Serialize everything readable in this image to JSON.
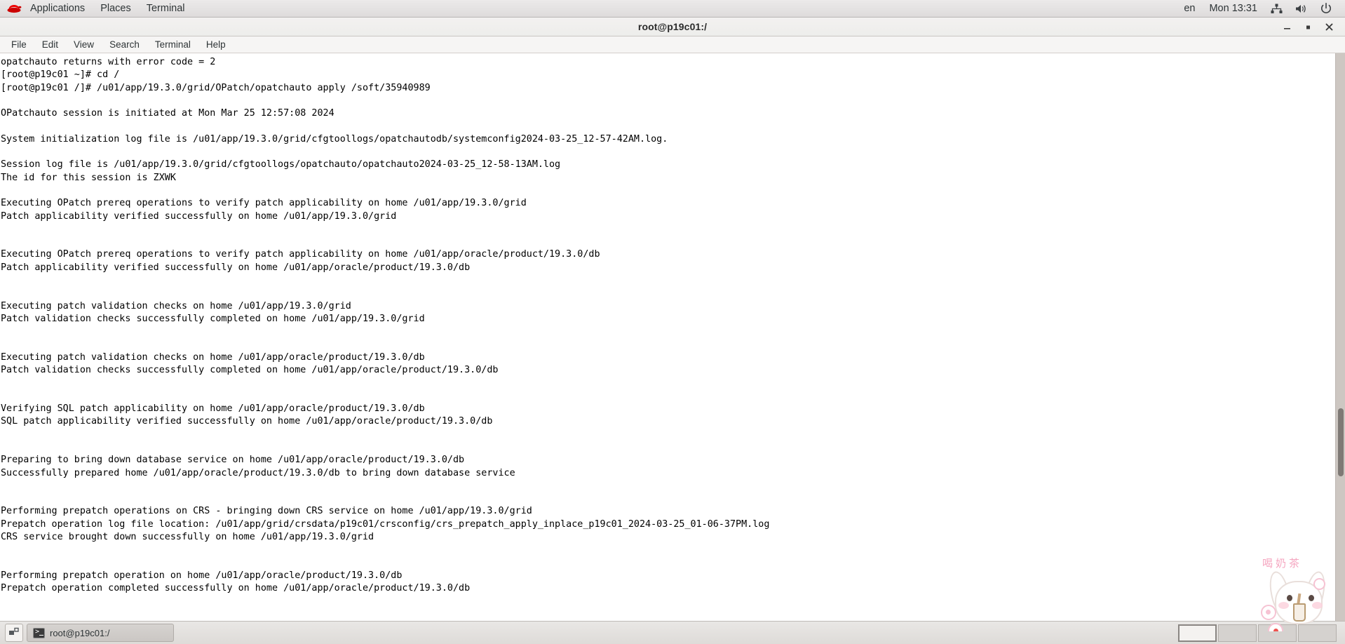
{
  "top_panel": {
    "logo_icon": "redhat-logo-icon",
    "menus": [
      "Applications",
      "Places",
      "Terminal"
    ],
    "language": "en",
    "clock": "Mon 13:31",
    "icons": [
      "network-icon",
      "volume-icon",
      "power-icon"
    ]
  },
  "window": {
    "title": "root@p19c01:/",
    "controls": {
      "minimize": "minimize-icon",
      "maximize": "maximize-icon",
      "close": "close-icon"
    },
    "menubar": [
      "File",
      "Edit",
      "View",
      "Search",
      "Terminal",
      "Help"
    ]
  },
  "terminal": {
    "content": "opatchauto returns with error code = 2\n[root@p19c01 ~]# cd /\n[root@p19c01 /]# /u01/app/19.3.0/grid/OPatch/opatchauto apply /soft/35940989\n\nOPatchauto session is initiated at Mon Mar 25 12:57:08 2024\n\nSystem initialization log file is /u01/app/19.3.0/grid/cfgtoollogs/opatchautodb/systemconfig2024-03-25_12-57-42AM.log.\n\nSession log file is /u01/app/19.3.0/grid/cfgtoollogs/opatchauto/opatchauto2024-03-25_12-58-13AM.log\nThe id for this session is ZXWK\n\nExecuting OPatch prereq operations to verify patch applicability on home /u01/app/19.3.0/grid\nPatch applicability verified successfully on home /u01/app/19.3.0/grid\n\n\nExecuting OPatch prereq operations to verify patch applicability on home /u01/app/oracle/product/19.3.0/db\nPatch applicability verified successfully on home /u01/app/oracle/product/19.3.0/db\n\n\nExecuting patch validation checks on home /u01/app/19.3.0/grid\nPatch validation checks successfully completed on home /u01/app/19.3.0/grid\n\n\nExecuting patch validation checks on home /u01/app/oracle/product/19.3.0/db\nPatch validation checks successfully completed on home /u01/app/oracle/product/19.3.0/db\n\n\nVerifying SQL patch applicability on home /u01/app/oracle/product/19.3.0/db\nSQL patch applicability verified successfully on home /u01/app/oracle/product/19.3.0/db\n\n\nPreparing to bring down database service on home /u01/app/oracle/product/19.3.0/db\nSuccessfully prepared home /u01/app/oracle/product/19.3.0/db to bring down database service\n\n\nPerforming prepatch operations on CRS - bringing down CRS service on home /u01/app/19.3.0/grid\nPrepatch operation log file location: /u01/app/grid/crsdata/p19c01/crsconfig/crs_prepatch_apply_inplace_p19c01_2024-03-25_01-06-37PM.log\nCRS service brought down successfully on home /u01/app/19.3.0/grid\n\n\nPerforming prepatch operation on home /u01/app/oracle/product/19.3.0/db\nPrepatch operation completed successfully on home /u01/app/oracle/product/19.3.0/db"
  },
  "taskbar": {
    "show_desktop_icon": "show-desktop-icon",
    "windows": [
      {
        "icon": "terminal-icon",
        "label": "root@p19c01:/"
      }
    ],
    "workspace_count": 4,
    "active_workspace": 1
  },
  "sticker": {
    "text": "喝奶茶",
    "icon": "bunny-sticker-icon"
  },
  "colors": {
    "panel_bg": "#e4e2e2",
    "terminal_bg": "#ffffff",
    "terminal_fg": "#000000",
    "accent": "#ee0000"
  }
}
